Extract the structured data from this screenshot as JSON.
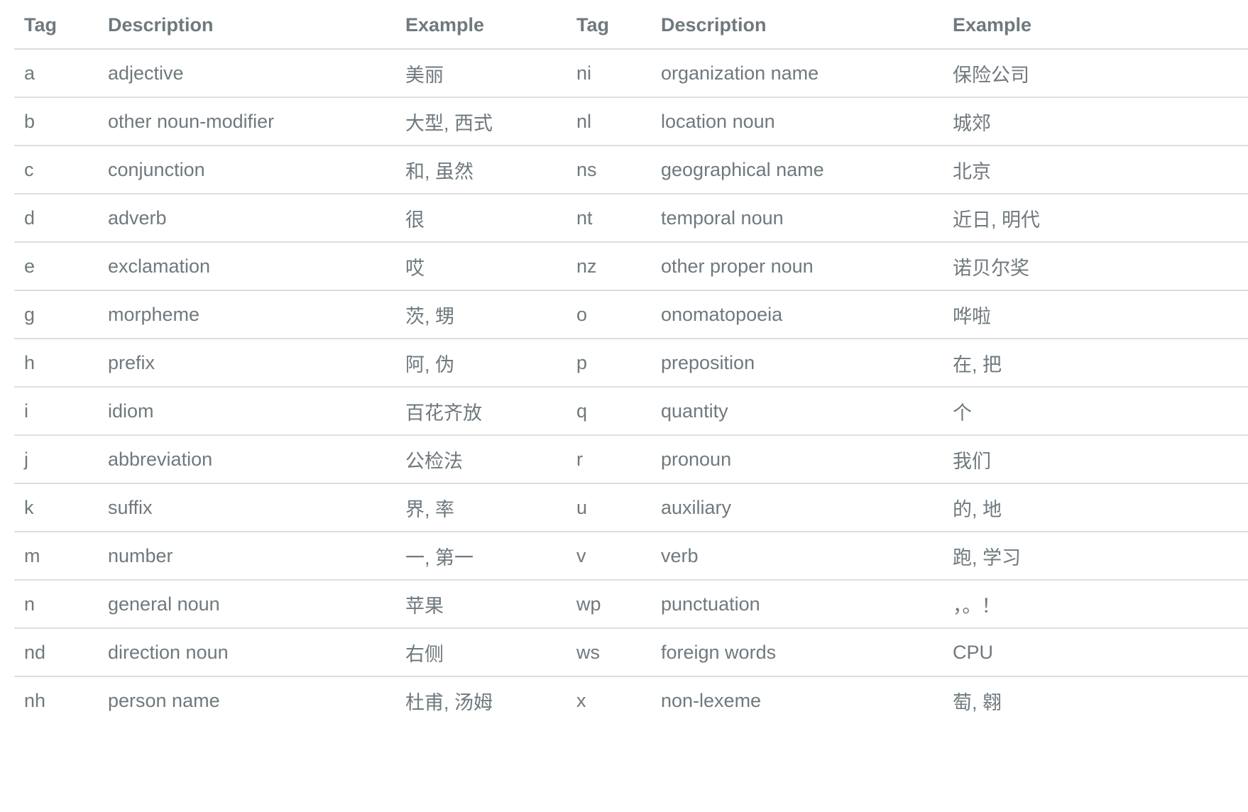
{
  "headers": [
    "Tag",
    "Description",
    "Example",
    "Tag",
    "Description",
    "Example"
  ],
  "rows": [
    [
      "a",
      "adjective",
      "美丽",
      "ni",
      "organization name",
      "保险公司"
    ],
    [
      "b",
      "other noun-modifier",
      "大型, 西式",
      "nl",
      "location noun",
      "城郊"
    ],
    [
      "c",
      "conjunction",
      "和, 虽然",
      "ns",
      "geographical name",
      "北京"
    ],
    [
      "d",
      "adverb",
      "很",
      "nt",
      "temporal noun",
      "近日, 明代"
    ],
    [
      "e",
      "exclamation",
      "哎",
      "nz",
      "other proper noun",
      "诺贝尔奖"
    ],
    [
      "g",
      "morpheme",
      "茨, 甥",
      "o",
      "onomatopoeia",
      "哗啦"
    ],
    [
      "h",
      "prefix",
      "阿, 伪",
      "p",
      "preposition",
      "在, 把"
    ],
    [
      "i",
      "idiom",
      "百花齐放",
      "q",
      "quantity",
      "个"
    ],
    [
      "j",
      "abbreviation",
      "公检法",
      "r",
      "pronoun",
      "我们"
    ],
    [
      "k",
      "suffix",
      "界, 率",
      "u",
      "auxiliary",
      "的, 地"
    ],
    [
      "m",
      "number",
      "一, 第一",
      "v",
      "verb",
      "跑, 学习"
    ],
    [
      "n",
      "general noun",
      "苹果",
      "wp",
      "punctuation",
      "，。！"
    ],
    [
      "nd",
      "direction noun",
      "右侧",
      "ws",
      "foreign words",
      "CPU"
    ],
    [
      "nh",
      "person name",
      "杜甫, 汤姆",
      "x",
      "non-lexeme",
      "萄, 翱"
    ]
  ]
}
